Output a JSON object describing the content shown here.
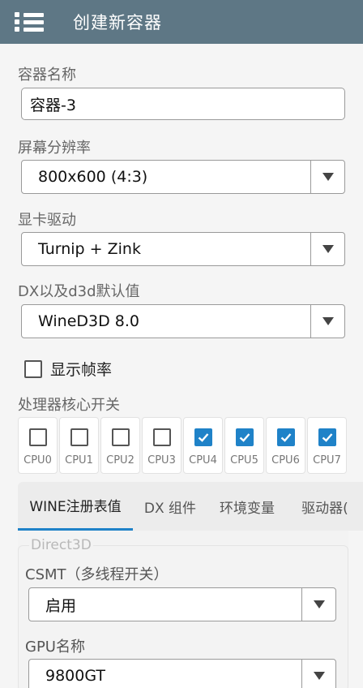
{
  "header": {
    "title": "创建新容器"
  },
  "form": {
    "name_label": "容器名称",
    "name_value": "容器-3",
    "resolution_label": "屏幕分辨率",
    "resolution_value": "800x600 (4:3)",
    "gpu_driver_label": "显卡驱动",
    "gpu_driver_value": "Turnip + Zink",
    "dx_label": "DX以及d3d默认值",
    "dx_value": "WineD3D 8.0",
    "show_fps_label": "显示帧率",
    "cpu_label": "处理器核心开关",
    "cpus": [
      {
        "name": "CPU0",
        "checked": false
      },
      {
        "name": "CPU1",
        "checked": false
      },
      {
        "name": "CPU2",
        "checked": false
      },
      {
        "name": "CPU3",
        "checked": false
      },
      {
        "name": "CPU4",
        "checked": true
      },
      {
        "name": "CPU5",
        "checked": true
      },
      {
        "name": "CPU6",
        "checked": true
      },
      {
        "name": "CPU7",
        "checked": true
      }
    ]
  },
  "tabs": [
    {
      "label": "WINE注册表值",
      "active": true
    },
    {
      "label": "DX 组件",
      "active": false
    },
    {
      "label": "环境变量",
      "active": false
    },
    {
      "label": "驱动器(",
      "active": false
    }
  ],
  "direct3d": {
    "legend": "Direct3D",
    "csmt_label": "CSMT（多线程开关）",
    "csmt_value": "启用",
    "gpu_name_label": "GPU名称",
    "gpu_name_value": "9800GT"
  },
  "colors": {
    "appbar": "#5e7785",
    "accent": "#1f82c8"
  }
}
